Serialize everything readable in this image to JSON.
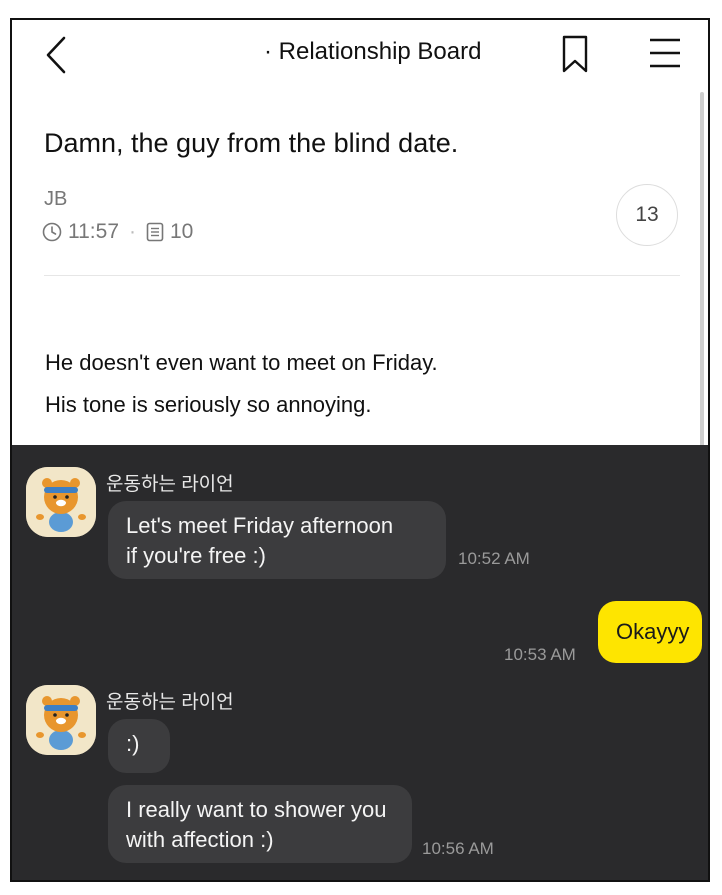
{
  "header": {
    "title": "· Relationship Board"
  },
  "post": {
    "title": "Damn, the guy from the blind date.",
    "author": "JB",
    "time": "11:57",
    "views": "10",
    "comment_count": "13",
    "body": [
      "He doesn't even want to meet on Friday.",
      "His tone is seriously so annoying."
    ]
  },
  "chat": {
    "messages": [
      {
        "sender": "운동하는 라이언",
        "lines": [
          "Let's meet Friday afternoon",
          "if you're free :)"
        ],
        "time": "10:52 AM"
      },
      {
        "sender": "me",
        "lines": [
          "Okayyy"
        ],
        "time": "10:53 AM"
      },
      {
        "sender": "운동하는 라이언",
        "lines": [
          ":)"
        ]
      },
      {
        "sender": "운동하는 라이언",
        "lines": [
          "I really want to shower you",
          "with affection :)"
        ],
        "time": "10:56 AM"
      }
    ]
  },
  "colors": {
    "chat_bg": "#2a2a2c",
    "bubble_other": "#3c3c3e",
    "bubble_mine": "#fee500"
  }
}
